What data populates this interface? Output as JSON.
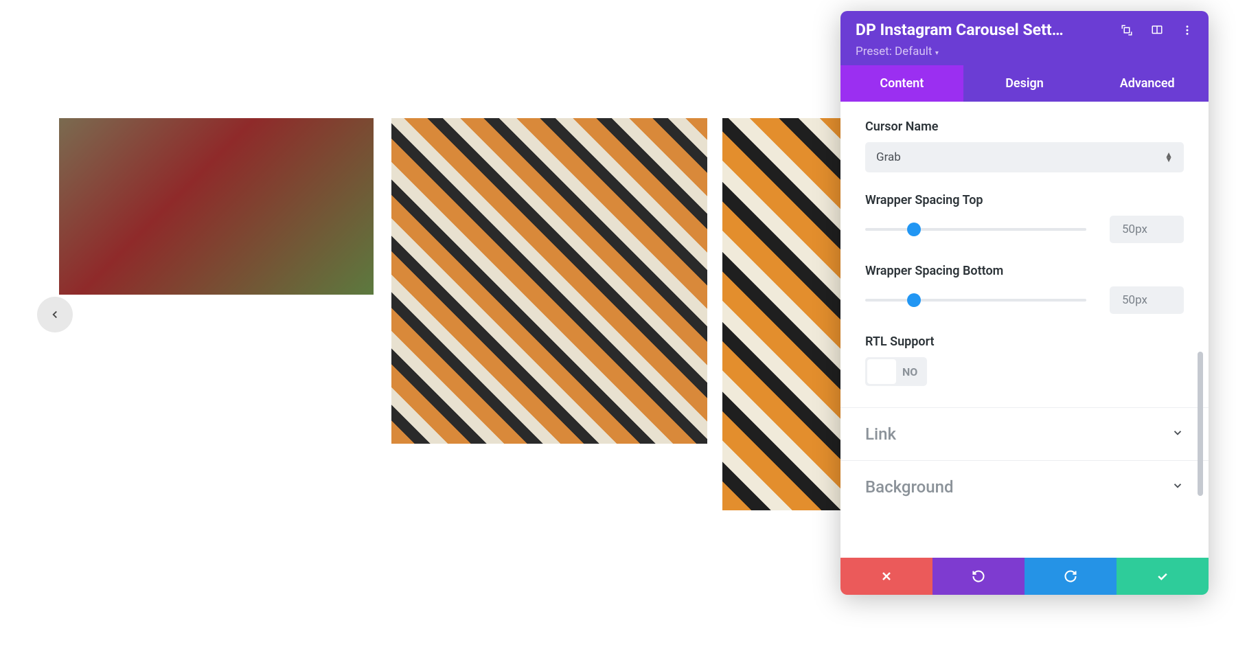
{
  "panel": {
    "title": "DP Instagram Carousel Sett…",
    "preset_label": "Preset: Default"
  },
  "tabs": {
    "content": "Content",
    "design": "Design",
    "advanced": "Advanced"
  },
  "fields": {
    "cursor_name": {
      "label": "Cursor Name",
      "value": "Grab"
    },
    "wrapper_top": {
      "label": "Wrapper Spacing Top",
      "value": "50px",
      "thumb_pct": 22
    },
    "wrapper_bottom": {
      "label": "Wrapper Spacing Bottom",
      "value": "50px",
      "thumb_pct": 22
    },
    "rtl": {
      "label": "RTL Support",
      "value": "NO"
    }
  },
  "sections": {
    "link": "Link",
    "background": "Background"
  }
}
